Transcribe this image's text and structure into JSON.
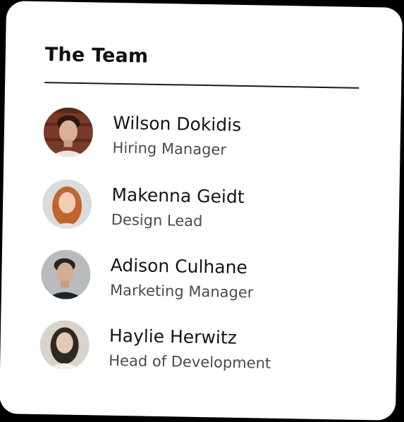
{
  "card": {
    "title": "The Team"
  },
  "members": [
    {
      "name": "Wilson Dokidis",
      "role": "Hiring Manager"
    },
    {
      "name": "Makenna Geidt",
      "role": "Design Lead"
    },
    {
      "name": "Adison Culhane",
      "role": "Marketing Manager"
    },
    {
      "name": "Haylie Herwitz",
      "role": "Head of Development"
    }
  ],
  "colors": {
    "background": "#000000",
    "card": "#ffffff",
    "title_text": "#111111",
    "name_text": "#141414",
    "role_text": "#4a4a4a",
    "divider": "#1a1a1a"
  }
}
